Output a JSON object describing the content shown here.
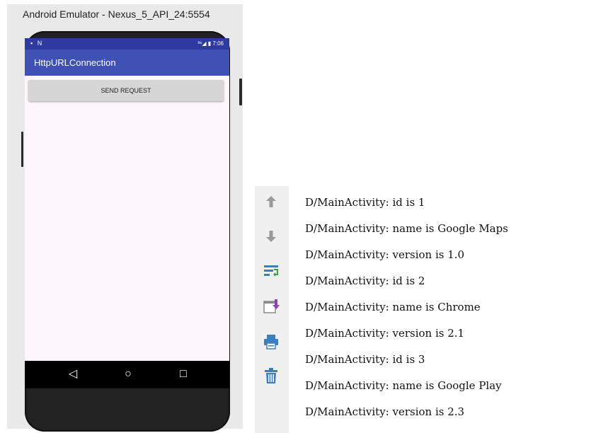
{
  "emulator": {
    "window_title": "Android Emulator - Nexus_5_API_24:5554",
    "status_bar": {
      "left_icons": "▪ N",
      "right_text": "ˡᵗᵉ◢ ▮ 7:06"
    },
    "app_bar_title": "HttpURLConnection",
    "send_button_label": "SEND REQUEST",
    "nav": {
      "back": "◁",
      "home": "○",
      "recents": "□"
    },
    "colors": {
      "app_bar": "#3f51b5",
      "status_bar": "#2e3a9e",
      "screen_bg": "#fdf7fc"
    }
  },
  "logcat": {
    "toolbar_icons": [
      "up-arrow-icon",
      "down-arrow-icon",
      "soft-wrap-icon",
      "scroll-to-end-icon",
      "print-icon",
      "trash-icon"
    ],
    "lines": [
      "D/MainActivity: id is 1",
      "D/MainActivity: name is Google Maps",
      "D/MainActivity: version is 1.0",
      "D/MainActivity: id is 2",
      "D/MainActivity: name is Chrome",
      "D/MainActivity: version is 2.1",
      "D/MainActivity: id is 3",
      "D/MainActivity: name is Google Play",
      "D/MainActivity: version is 2.3"
    ]
  }
}
